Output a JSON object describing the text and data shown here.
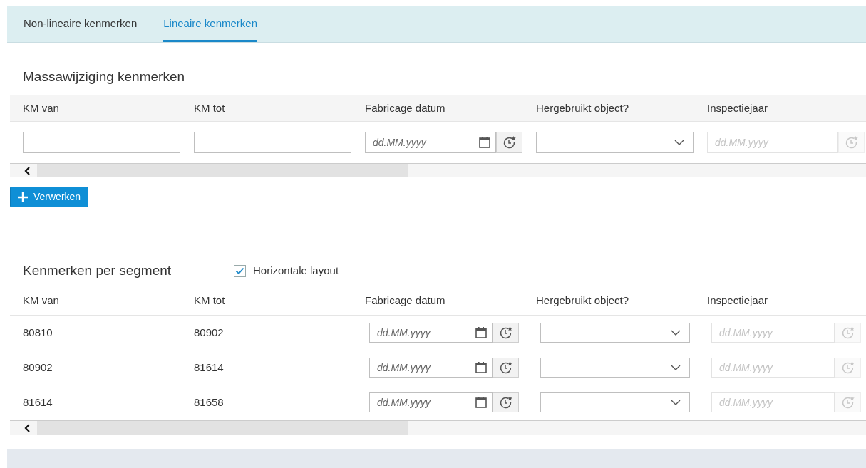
{
  "tabs": [
    {
      "label": "Non-lineaire kenmerken",
      "selected": false
    },
    {
      "label": "Lineaire kenmerken",
      "selected": true
    }
  ],
  "mass_edit": {
    "title": "Massawijziging kenmerken",
    "columns": [
      "KM van",
      "KM tot",
      "Fabricage datum",
      "Hergebruikt object?",
      "Inspectiejaar"
    ],
    "fields": [
      {
        "kind": "text",
        "disabled": false
      },
      {
        "kind": "text",
        "disabled": false
      },
      {
        "kind": "date",
        "placeholder": "dd.MM.yyyy",
        "disabled": false
      },
      {
        "kind": "select",
        "disabled": false
      },
      {
        "kind": "date",
        "placeholder": "dd.MM.yyyy",
        "disabled": true
      }
    ],
    "button": "Verwerken"
  },
  "segments": {
    "title": "Kenmerken per segment",
    "layout_checkbox": {
      "label": "Horizontale layout",
      "checked": true
    },
    "columns": [
      "KM van",
      "KM tot",
      "Fabricage datum",
      "Hergebruikt object?",
      "Inspectiejaar"
    ],
    "rows": [
      {
        "km_van": "80810",
        "km_tot": "80902",
        "fields": [
          {
            "kind": "date",
            "placeholder": "dd.MM.yyyy",
            "disabled": false
          },
          {
            "kind": "select",
            "disabled": false
          },
          {
            "kind": "date",
            "placeholder": "dd.MM.yyyy",
            "disabled": true
          }
        ]
      },
      {
        "km_van": "80902",
        "km_tot": "81614",
        "fields": [
          {
            "kind": "date",
            "placeholder": "dd.MM.yyyy",
            "disabled": false
          },
          {
            "kind": "select",
            "disabled": false
          },
          {
            "kind": "date",
            "placeholder": "dd.MM.yyyy",
            "disabled": true
          }
        ]
      },
      {
        "km_van": "81614",
        "km_tot": "81658",
        "fields": [
          {
            "kind": "date",
            "placeholder": "dd.MM.yyyy",
            "disabled": false
          },
          {
            "kind": "select",
            "disabled": false
          },
          {
            "kind": "date",
            "placeholder": "dd.MM.yyyy",
            "disabled": true
          }
        ]
      }
    ]
  }
}
